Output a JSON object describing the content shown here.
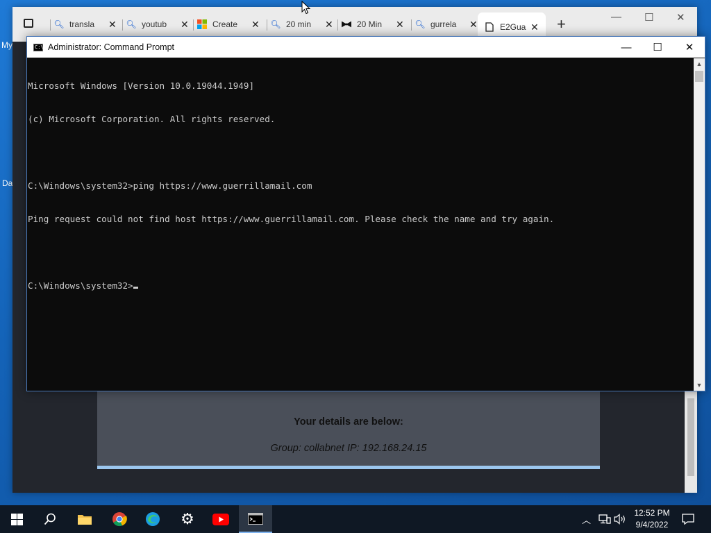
{
  "desktop": {
    "icon_labels": [
      "My",
      "Da"
    ]
  },
  "browser": {
    "tabs": [
      {
        "label": "transla",
        "icon": "search-icon",
        "active": false
      },
      {
        "label": "youtub",
        "icon": "search-icon",
        "active": false
      },
      {
        "label": "Create",
        "icon": "microsoft-logo-icon",
        "active": false
      },
      {
        "label": "20 min",
        "icon": "search-icon",
        "active": false
      },
      {
        "label": "20 Min",
        "icon": "bowtie-icon",
        "active": false
      },
      {
        "label": "gurrela",
        "icon": "search-icon",
        "active": false
      },
      {
        "label": "E2Gua",
        "icon": "page-icon",
        "active": true
      }
    ],
    "page": {
      "details_title": "Your details are below:",
      "details_line": "Group: collabnet   IP: 192.168.24.15"
    }
  },
  "cmd": {
    "title": "Administrator: Command Prompt",
    "lines": [
      "Microsoft Windows [Version 10.0.19044.1949]",
      "(c) Microsoft Corporation. All rights reserved.",
      "",
      "C:\\Windows\\system32>ping https://www.guerrillamail.com",
      "Ping request could not find host https://www.guerrillamail.com. Please check the name and try again.",
      "",
      "C:\\Windows\\system32>"
    ]
  },
  "taskbar": {
    "time": "12:52 PM",
    "date": "9/4/2022"
  }
}
